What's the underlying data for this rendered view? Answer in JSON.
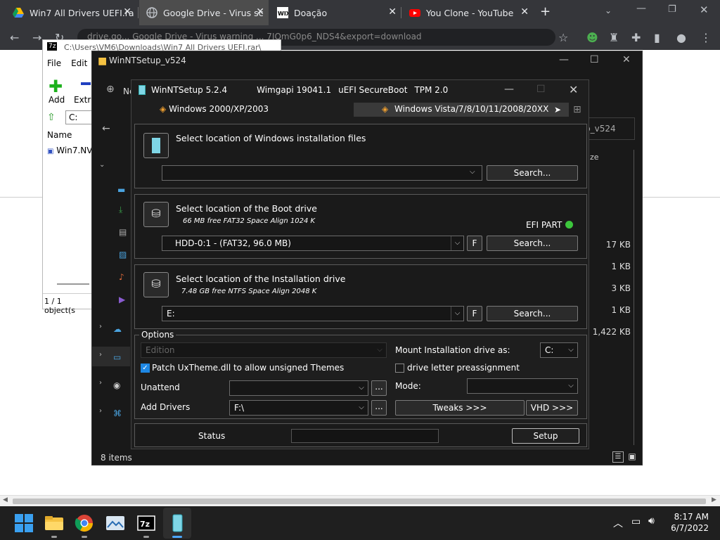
{
  "browser": {
    "tabs": [
      {
        "title": "Win7 All Drivers UEFI.ra",
        "favicon": "google-drive-icon"
      },
      {
        "title": "Google Drive - Virus sc",
        "favicon": "globe-icon"
      },
      {
        "title": "Doação",
        "favicon": "wix-icon"
      },
      {
        "title": "You Clone - YouTube",
        "favicon": "youtube-icon"
      }
    ],
    "new_tab": "+",
    "address": "drive.go... Google Drive - Virus warning ... 7JQmG0p6_NDS4&export=download"
  },
  "zip": {
    "title": "C:\\Users\\VM6\\Downloads\\Win7 All Drivers UEFI.rar\\",
    "menu": [
      "File",
      "Edit"
    ],
    "add_label": "Add",
    "extract_label": "Extra",
    "path": "C:",
    "col_name": "Name",
    "file": "Win7.NV",
    "status": "1 / 1 object(s"
  },
  "explorer": {
    "title": "WinNTSetup_v524",
    "new_label": "Ne",
    "search_hint": "p_v524",
    "col_size": "ze",
    "sizes": [
      "17 KB",
      "1 KB",
      "3 KB",
      "1 KB",
      "1,422 KB"
    ],
    "items_count": "8 items"
  },
  "wnt": {
    "title": "WinNTSetup 5.2.4",
    "wimgapi": "Wimgapi 19041.1",
    "secureboot": "uEFI SecureBoot",
    "tpm": "TPM 2.0",
    "tab_xp": "Windows 2000/XP/2003",
    "tab_vista": "Windows Vista/7/8/10/11/2008/20XX",
    "install_files": {
      "title": "Select location of Windows installation files",
      "value": "",
      "search": "Search..."
    },
    "boot_drive": {
      "title": "Select location of the Boot drive",
      "sub": "66 MB free FAT32 Space Align 1024 K",
      "value": "HDD-0:1 -   (FAT32, 96.0 MB)",
      "efi": "EFI PART",
      "f": "F",
      "search": "Search..."
    },
    "install_drive": {
      "title": "Select location of the Installation drive",
      "sub": "7.48 GB free NTFS Space Align 2048 K",
      "value": "E:",
      "f": "F",
      "search": "Search..."
    },
    "options": {
      "legend": "Options",
      "edition": "Edition",
      "mount_label": "Mount Installation drive as:",
      "mount_value": "C:",
      "patch": "Patch UxTheme.dll to allow unsigned Themes",
      "patch_checked": true,
      "drive_letter": "drive letter preassignment",
      "drive_letter_checked": false,
      "unattend": "Unattend",
      "unattend_value": "",
      "mode": "Mode:",
      "mode_value": "",
      "add_drivers": "Add Drivers",
      "add_drivers_value": "F:\\",
      "ellipsis": "...",
      "tweaks": "Tweaks >>>",
      "vhd": "VHD >>>"
    },
    "status_label": "Status",
    "setup": "Setup"
  },
  "taskbar": {
    "time": "8:17 AM",
    "date": "6/7/2022",
    "apps": [
      "windows-start-icon",
      "file-explorer-icon",
      "chrome-icon",
      "photos-icon",
      "7zip-icon",
      "winntsetup-icon"
    ]
  },
  "colors": {
    "efi_led": "#3cc63c",
    "check": "#1e88e5",
    "youtube": "#ff0000",
    "winlogo": "#0078d4"
  }
}
